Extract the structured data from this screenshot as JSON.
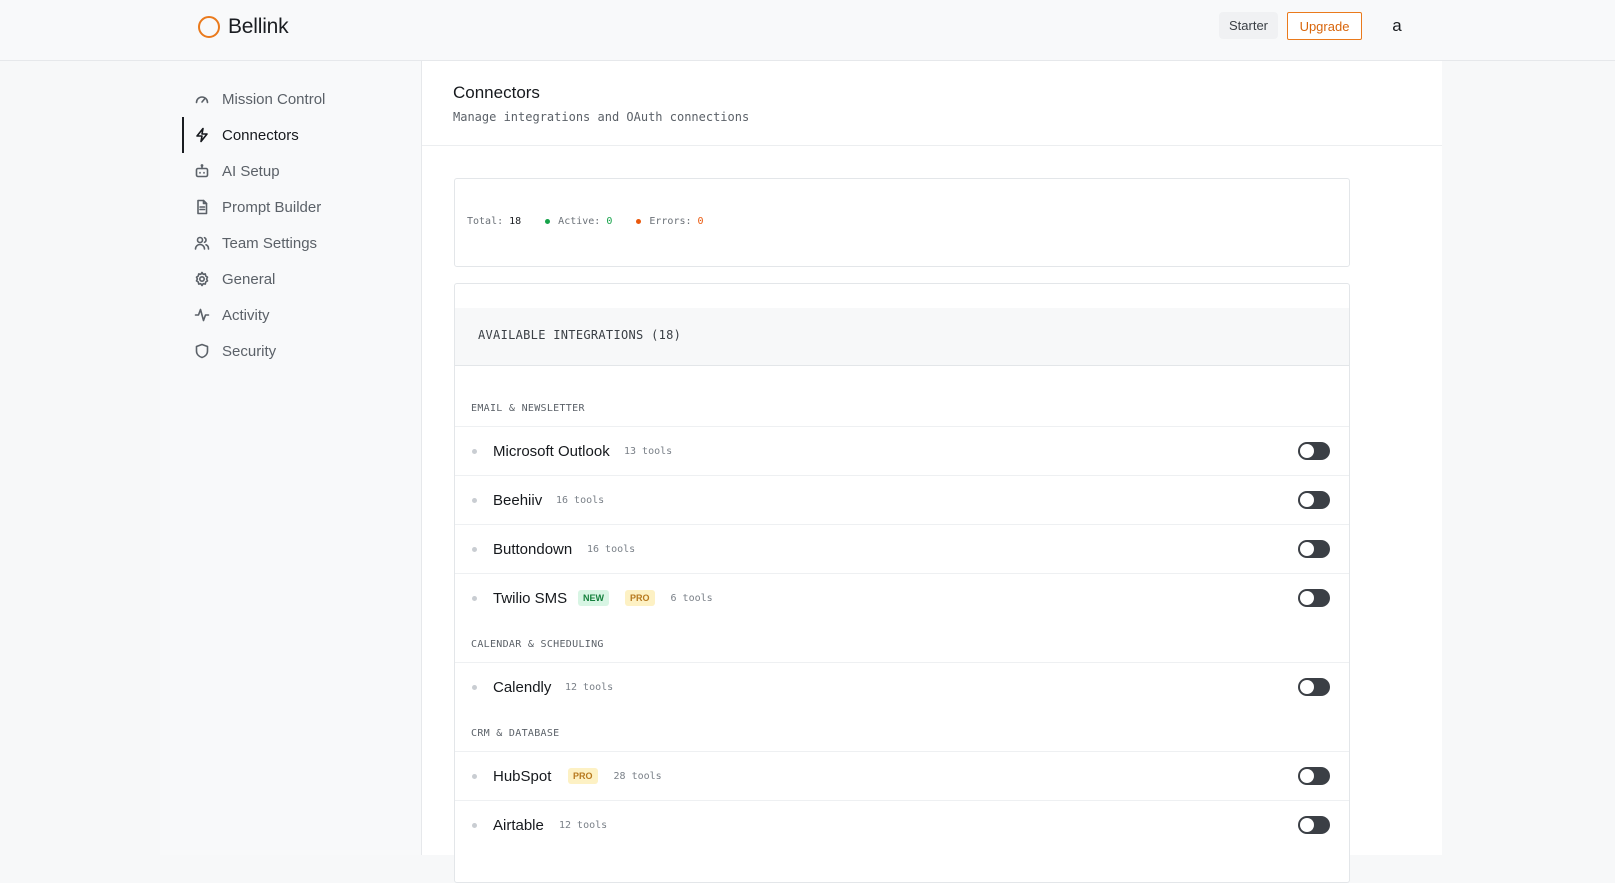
{
  "header": {
    "brand": "Bellink",
    "plan": "Starter",
    "upgrade_label": "Upgrade",
    "avatar_initial": "a",
    "accent": "#ea7a1c"
  },
  "sidebar": {
    "items": [
      {
        "label": "Mission Control",
        "icon": "gauge-icon",
        "active": false
      },
      {
        "label": "Connectors",
        "icon": "lightning-icon",
        "active": true
      },
      {
        "label": "AI Setup",
        "icon": "robot-icon",
        "active": false
      },
      {
        "label": "Prompt Builder",
        "icon": "document-icon",
        "active": false
      },
      {
        "label": "Team Settings",
        "icon": "users-icon",
        "active": false
      },
      {
        "label": "General",
        "icon": "gear-icon",
        "active": false
      },
      {
        "label": "Activity",
        "icon": "activity-icon",
        "active": false
      },
      {
        "label": "Security",
        "icon": "shield-icon",
        "active": false
      }
    ]
  },
  "page": {
    "title": "Connectors",
    "subtitle": "Manage integrations and OAuth connections"
  },
  "stats": {
    "total_label": "Total:",
    "total_value": "18",
    "active_label": "Active:",
    "active_value": "0",
    "errors_label": "Errors:",
    "errors_value": "0"
  },
  "integrations": {
    "title": "AVAILABLE INTEGRATIONS (18)",
    "groups": [
      {
        "label": "EMAIL & NEWSLETTER",
        "items": [
          {
            "name": "Microsoft Outlook",
            "badges": [],
            "tools": "13 tools",
            "enabled": false
          },
          {
            "name": "Beehiiv",
            "badges": [],
            "tools": "16 tools",
            "enabled": false
          },
          {
            "name": "Buttondown",
            "badges": [],
            "tools": "16 tools",
            "enabled": false
          },
          {
            "name": "Twilio SMS",
            "badges": [
              "NEW",
              "PRO"
            ],
            "tools": "6 tools",
            "enabled": false
          }
        ]
      },
      {
        "label": "CALENDAR & SCHEDULING",
        "items": [
          {
            "name": "Calendly",
            "badges": [],
            "tools": "12 tools",
            "enabled": false
          }
        ]
      },
      {
        "label": "CRM & DATABASE",
        "items": [
          {
            "name": "HubSpot",
            "badges": [
              "PRO"
            ],
            "tools": "28 tools",
            "enabled": false
          },
          {
            "name": "Airtable",
            "badges": [],
            "tools": "12 tools",
            "enabled": false
          }
        ]
      }
    ]
  }
}
